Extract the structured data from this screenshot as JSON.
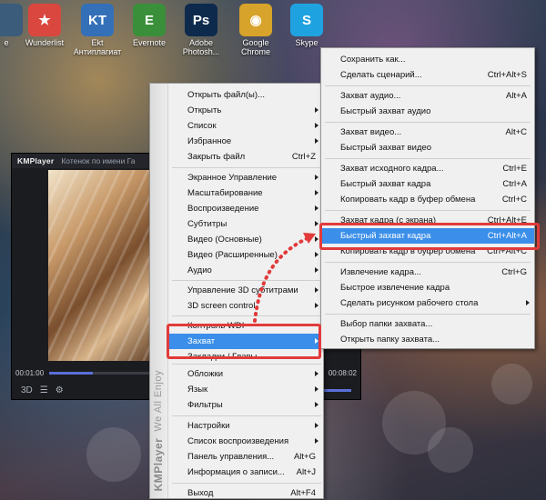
{
  "desktop": {
    "icons": [
      {
        "name": "recycle-bin-icon",
        "label": "е",
        "color": "#3b5c7a",
        "glyph": ""
      },
      {
        "name": "wunderlist-icon",
        "label": "Wunderlist",
        "color": "#d9473f",
        "glyph": "★"
      },
      {
        "name": "ekt-icon",
        "label": "Ekt Антиплагиат",
        "color": "#3370b8",
        "glyph": "KT"
      },
      {
        "name": "evernote-icon",
        "label": "Evernote",
        "color": "#3a8f3a",
        "glyph": "E"
      },
      {
        "name": "photoshop-icon",
        "label": "Adobe Photosh...",
        "color": "#0d2a4d",
        "glyph": "Ps"
      },
      {
        "name": "chrome-icon",
        "label": "Google Chrome",
        "color": "#d8a32a",
        "glyph": "◉"
      },
      {
        "name": "skype-icon",
        "label": "Skype",
        "color": "#1fa3e0",
        "glyph": "S"
      }
    ]
  },
  "player": {
    "brand": "KMPlayer",
    "caption": "Котенок по имени Га",
    "time_current": "00:01:00",
    "time_total": "00:08:02",
    "progress_fraction": 0.16
  },
  "main_menu": {
    "side_text": "We All Enjoy",
    "side_brand": "KMPlayer",
    "items": [
      {
        "label": "Открыть файл(ы)...",
        "shortcut": "",
        "arrow": false
      },
      {
        "label": "Открыть",
        "shortcut": "",
        "arrow": true
      },
      {
        "label": "Список",
        "shortcut": "",
        "arrow": true
      },
      {
        "label": "Избранное",
        "shortcut": "",
        "arrow": true
      },
      {
        "label": "Закрыть файл",
        "shortcut": "Ctrl+Z",
        "arrow": false
      },
      {
        "label": "Экранное Управление",
        "shortcut": "",
        "arrow": true
      },
      {
        "label": "Масштабирование",
        "shortcut": "",
        "arrow": true
      },
      {
        "label": "Воспроизведение",
        "shortcut": "",
        "arrow": true
      },
      {
        "label": "Субтитры",
        "shortcut": "",
        "arrow": true
      },
      {
        "label": "Видео (Основные)",
        "shortcut": "",
        "arrow": true
      },
      {
        "label": "Видео (Расширенные)",
        "shortcut": "",
        "arrow": true
      },
      {
        "label": "Аудио",
        "shortcut": "",
        "arrow": true
      },
      {
        "label": "Управление 3D субтитрами",
        "shortcut": "",
        "arrow": true
      },
      {
        "label": "3D screen control",
        "shortcut": "",
        "arrow": true
      },
      {
        "label": "Контроль WDI",
        "shortcut": "",
        "arrow": false
      },
      {
        "label": "Захват",
        "shortcut": "",
        "arrow": true,
        "selected": true
      },
      {
        "label": "Закладки / Главы",
        "shortcut": "",
        "arrow": false
      },
      {
        "label": "Обложки",
        "shortcut": "",
        "arrow": true
      },
      {
        "label": "Язык",
        "shortcut": "",
        "arrow": true
      },
      {
        "label": "Фильтры",
        "shortcut": "",
        "arrow": true
      },
      {
        "label": "Настройки",
        "shortcut": "",
        "arrow": true
      },
      {
        "label": "Список воспроизведения",
        "shortcut": "",
        "arrow": true
      },
      {
        "label": "Панель управления...",
        "shortcut": "Alt+G",
        "arrow": false
      },
      {
        "label": "Информация о записи...",
        "shortcut": "Alt+J",
        "arrow": false
      },
      {
        "label": "Выход",
        "shortcut": "Alt+F4",
        "arrow": false
      }
    ]
  },
  "sub_menu": {
    "items": [
      {
        "label": "Сохранить как...",
        "shortcut": ""
      },
      {
        "label": "Сделать сценарий...",
        "shortcut": "Ctrl+Alt+S"
      },
      {
        "label": "Захват аудио...",
        "shortcut": "Alt+A"
      },
      {
        "label": "Быстрый захват аудио",
        "shortcut": ""
      },
      {
        "label": "Захват видео...",
        "shortcut": "Alt+C"
      },
      {
        "label": "Быстрый захват видео",
        "shortcut": ""
      },
      {
        "label": "Захват исходного кадра...",
        "shortcut": "Ctrl+E"
      },
      {
        "label": "Быстрый захват кадра",
        "shortcut": "Ctrl+A"
      },
      {
        "label": "Копировать кадр в буфер обмена",
        "shortcut": "Ctrl+C"
      },
      {
        "label": "Захват кадра (с экрана)",
        "shortcut": "Ctrl+Alt+E"
      },
      {
        "label": "Быстрый захват кадра",
        "shortcut": "Ctrl+Alt+A",
        "selected": true
      },
      {
        "label": "Копировать кадр в буфер обмена",
        "shortcut": "Ctrl+Alt+C"
      },
      {
        "label": "Извлечение кадра...",
        "shortcut": "Ctrl+G"
      },
      {
        "label": "Быстрое извлечение кадра",
        "shortcut": ""
      },
      {
        "label": "Сделать рисунком рабочего стола",
        "shortcut": "",
        "arrow": true
      },
      {
        "label": "Выбор папки захвата...",
        "shortcut": ""
      },
      {
        "label": "Открыть папку захвата...",
        "shortcut": ""
      }
    ]
  },
  "colors": {
    "highlight": "#3b8ee9",
    "annotation": "#e23a3a"
  }
}
